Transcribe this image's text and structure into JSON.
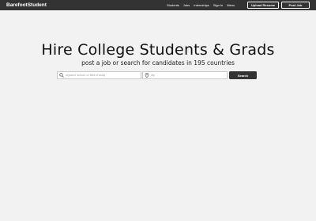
{
  "navbar": {
    "brand": "BarefootStudent",
    "links": [
      "Students",
      "Jobs",
      "Internships",
      "Sign In",
      "Menu"
    ],
    "upload_resume": "Upload Resume",
    "post_job": "Post Job"
  },
  "hero": {
    "title": "Hire College Students & Grads",
    "subtitle": "post a job or search for candidates in 195 countries"
  },
  "search": {
    "keyword_placeholder": "keyword, school, or field of study",
    "city_placeholder": "city",
    "button_label": "Search"
  },
  "colors": {
    "navbar_bg": "#333333",
    "page_bg": "#f2f2f2",
    "button_bg": "#333333"
  }
}
